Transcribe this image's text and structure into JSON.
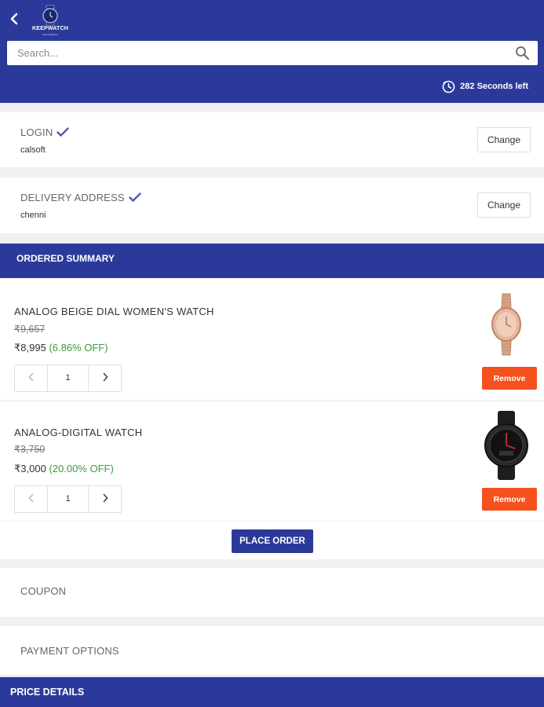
{
  "header": {
    "logo_text": "KEEPWATCH",
    "logo_subtext": "Smart Watches",
    "search_placeholder": "Search...",
    "timer_text": "282 Seconds left"
  },
  "login": {
    "label": "LOGIN",
    "value": "calsoft",
    "change_label": "Change"
  },
  "delivery": {
    "label": "DELIVERY ADDRESS",
    "value": "chenni",
    "change_label": "Change"
  },
  "summary": {
    "title": "ORDERED SUMMARY"
  },
  "items": [
    {
      "name": "ANALOG BEIGE DIAL WOMEN'S WATCH",
      "mrp": "₹9,657",
      "price": "₹8,995",
      "discount": "(6.86% OFF)",
      "quantity": "1",
      "remove_label": "Remove"
    },
    {
      "name": "ANALOG-DIGITAL WATCH",
      "mrp": "₹3,750",
      "price": "₹3,000",
      "discount": "(20.00% OFF)",
      "quantity": "1",
      "remove_label": "Remove"
    }
  ],
  "place_order_label": "PLACE ORDER",
  "coupon_label": "COUPON",
  "payment_label": "PAYMENT OPTIONS",
  "price_details_title": "PRICE DETAILS",
  "colors": {
    "primary": "#2b3a9a",
    "remove": "#f4511e",
    "discount": "#3c9a3c",
    "background": "#f1f1f4"
  },
  "icons": [
    "back-arrow-icon",
    "keepwatch-logo",
    "search-icon",
    "timer-icon",
    "check-icon",
    "chevron-left-icon",
    "chevron-right-icon"
  ]
}
